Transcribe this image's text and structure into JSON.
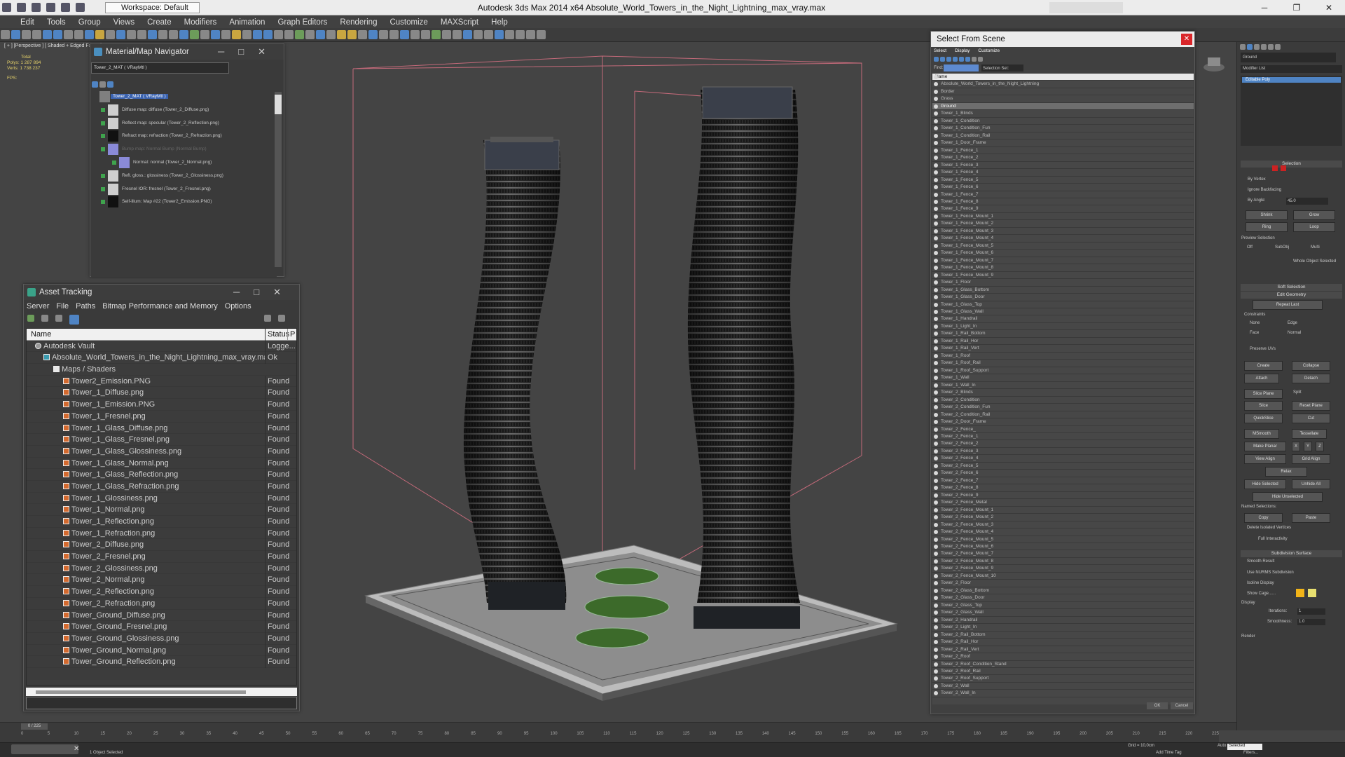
{
  "app": {
    "window_title": "Autodesk 3ds Max  2014 x64    Absolute_World_Towers_in_the_Night_Lightning_max_vray.max",
    "workspace": "Workspace: Default"
  },
  "menu": [
    "Edit",
    "Tools",
    "Group",
    "Views",
    "Create",
    "Modifiers",
    "Animation",
    "Graph Editors",
    "Rendering",
    "Customize",
    "MAXScript",
    "Help"
  ],
  "viewport": {
    "label": "[ + ] [Perspective ] [ Shaded + Edged Faces ]",
    "stats_total": "Total",
    "stats_polys": "Polys:  1 287 894",
    "stats_verts": "Verts:   1 738 237",
    "fps": "FPS:"
  },
  "mat_nav": {
    "title": "Material/Map Navigator",
    "field": "Tower_2_MAT  ( VRayMtl )",
    "root": "Tower_2_MAT  ( VRayMtl )",
    "items": [
      "Diffuse map: diffuse (Tower_2_Diffuse.png)",
      "Reflect map: specular (Tower_2_Reflection.png)",
      "Refract map: refraction (Tower_2_Refraction.png)",
      "Bump map: Normal Bump (Normal Bump)",
      "Normal: normal (Tower_2_Normal.png)",
      "Refl. gloss.: glossiness (Tower_2_Glossiness.png)",
      "Fresnel IOR: fresnel (Tower_2_Fresnel.png)",
      "Self-illum: Map #22 (Tower2_Emission.PNG)"
    ]
  },
  "asset": {
    "title": "Asset Tracking",
    "menu": [
      "Server",
      "File",
      "Paths",
      "Bitmap Performance and Memory",
      "Options"
    ],
    "col_name": "Name",
    "col_status": "Status",
    "col_p": "P",
    "vault": {
      "name": "Autodesk Vault",
      "status": "Logge..."
    },
    "file": {
      "name": "Absolute_World_Towers_in_the_Night_Lightning_max_vray.max",
      "status": "Ok"
    },
    "folder": "Maps / Shaders",
    "rows": [
      [
        "Tower2_Emission.PNG",
        "Found"
      ],
      [
        "Tower_1_Diffuse.png",
        "Found"
      ],
      [
        "Tower_1_Emission.PNG",
        "Found"
      ],
      [
        "Tower_1_Fresnel.png",
        "Found"
      ],
      [
        "Tower_1_Glass_Diffuse.png",
        "Found"
      ],
      [
        "Tower_1_Glass_Fresnel.png",
        "Found"
      ],
      [
        "Tower_1_Glass_Glossiness.png",
        "Found"
      ],
      [
        "Tower_1_Glass_Normal.png",
        "Found"
      ],
      [
        "Tower_1_Glass_Reflection.png",
        "Found"
      ],
      [
        "Tower_1_Glass_Refraction.png",
        "Found"
      ],
      [
        "Tower_1_Glossiness.png",
        "Found"
      ],
      [
        "Tower_1_Normal.png",
        "Found"
      ],
      [
        "Tower_1_Reflection.png",
        "Found"
      ],
      [
        "Tower_1_Refraction.png",
        "Found"
      ],
      [
        "Tower_2_Diffuse.png",
        "Found"
      ],
      [
        "Tower_2_Fresnel.png",
        "Found"
      ],
      [
        "Tower_2_Glossiness.png",
        "Found"
      ],
      [
        "Tower_2_Normal.png",
        "Found"
      ],
      [
        "Tower_2_Reflection.png",
        "Found"
      ],
      [
        "Tower_2_Refraction.png",
        "Found"
      ],
      [
        "Tower_Ground_Diffuse.png",
        "Found"
      ],
      [
        "Tower_Ground_Fresnel.png",
        "Found"
      ],
      [
        "Tower_Ground_Glossiness.png",
        "Found"
      ],
      [
        "Tower_Ground_Normal.png",
        "Found"
      ],
      [
        "Tower_Ground_Reflection.png",
        "Found"
      ]
    ]
  },
  "scene": {
    "title": "Select From Scene",
    "menu": [
      "Select",
      "Display",
      "Customize"
    ],
    "find_label": "Find:",
    "selset_label": "Selection Set:",
    "col_name": "Name",
    "ok": "OK",
    "cancel": "Cancel",
    "selected": "Ground",
    "items": [
      "Absolute_World_Towers_in_the_Night_Lightning",
      "Border",
      "Grass",
      "Ground",
      "Tower_1_Blinds",
      "Tower_1_Condition",
      "Tower_1_Condition_Fun",
      "Tower_1_Condition_Rail",
      "Tower_1_Door_Frame",
      "Tower_1_Fence_1",
      "Tower_1_Fence_2",
      "Tower_1_Fence_3",
      "Tower_1_Fence_4",
      "Tower_1_Fence_5",
      "Tower_1_Fence_6",
      "Tower_1_Fence_7",
      "Tower_1_Fence_8",
      "Tower_1_Fence_9",
      "Tower_1_Fence_Mount_1",
      "Tower_1_Fence_Mount_2",
      "Tower_1_Fence_Mount_3",
      "Tower_1_Fence_Mount_4",
      "Tower_1_Fence_Mount_5",
      "Tower_1_Fence_Mount_6",
      "Tower_1_Fence_Mount_7",
      "Tower_1_Fence_Mount_8",
      "Tower_1_Fence_Mount_9",
      "Tower_1_Floor",
      "Tower_1_Glass_Bottom",
      "Tower_1_Glass_Door",
      "Tower_1_Glass_Top",
      "Tower_1_Glass_Wall",
      "Tower_1_Handrail",
      "Tower_1_Light_In",
      "Tower_1_Rail_Bottom",
      "Tower_1_Rail_Hor",
      "Tower_1_Rail_Vert",
      "Tower_1_Roof",
      "Tower_1_Roof_Rail",
      "Tower_1_Roof_Support",
      "Tower_1_Wall",
      "Tower_1_Wall_In",
      "Tower_2_Blinds",
      "Tower_2_Condition",
      "Tower_2_Condition_Fun",
      "Tower_2_Condition_Rail",
      "Tower_2_Door_Frame",
      "Tower_2_Fence_",
      "Tower_2_Fence_1",
      "Tower_2_Fence_2",
      "Tower_2_Fence_3",
      "Tower_2_Fence_4",
      "Tower_2_Fence_5",
      "Tower_2_Fence_6",
      "Tower_2_Fence_7",
      "Tower_2_Fence_8",
      "Tower_2_Fence_9",
      "Tower_2_Fence_Metal",
      "Tower_2_Fence_Mount_1",
      "Tower_2_Fence_Mount_2",
      "Tower_2_Fence_Mount_3",
      "Tower_2_Fence_Mount_4",
      "Tower_2_Fence_Mount_5",
      "Tower_2_Fence_Mount_6",
      "Tower_2_Fence_Mount_7",
      "Tower_2_Fence_Mount_8",
      "Tower_2_Fence_Mount_9",
      "Tower_2_Fence_Mount_10",
      "Tower_2_Floor",
      "Tower_2_Glass_Bottom",
      "Tower_2_Glass_Door",
      "Tower_2_Glass_Top",
      "Tower_2_Glass_Wall",
      "Tower_2_Handrail",
      "Tower_2_Light_In",
      "Tower_2_Rail_Bottom",
      "Tower_2_Rail_Hor",
      "Tower_2_Rail_Vert",
      "Tower_2_Roof",
      "Tower_2_Roof_Condition_Stand",
      "Tower_2_Roof_Rail",
      "Tower_2_Roof_Support",
      "Tower_2_Wall",
      "Tower_2_Wall_In"
    ]
  },
  "cmd": {
    "object_name": "Ground",
    "modifier_list": "Modifier List",
    "stack_item": "Editable Poly",
    "selection": "Selection",
    "by_vertex": "By Vertex",
    "ignore_backfacing": "Ignore Backfacing",
    "by_angle": "By Angle:",
    "angle_val": "45.0",
    "shrink": "Shrink",
    "grow": "Grow",
    "ring": "Ring",
    "loop": "Loop",
    "preview_selection": "Preview Selection",
    "off": "Off",
    "subobj": "SubObj",
    "multi": "Multi",
    "whole_object": "Whole Object Selected",
    "soft_selection": "Soft Selection",
    "edit_geometry": "Edit Geometry",
    "repeat_last": "Repeat Last",
    "constraints": "Constraints",
    "none": "None",
    "edge": "Edge",
    "face": "Face",
    "normal": "Normal",
    "preserve_uvs": "Preserve UVs",
    "create": "Create",
    "collapse": "Collapse",
    "attach": "Attach",
    "detach": "Detach",
    "slice_plane": "Slice Plane",
    "split": "Split",
    "slice": "Slice",
    "reset_plane": "Reset Plane",
    "quickslice": "QuickSlice",
    "cut": "Cut",
    "msmooth": "MSmooth",
    "tessellate": "Tessellate",
    "make_planar": "Make Planar",
    "x": "X",
    "y": "Y",
    "z": "Z",
    "view_align": "View Align",
    "grid_align": "Grid Align",
    "relax": "Relax",
    "hide_selected": "Hide Selected",
    "unhide_all": "Unhide All",
    "hide_unselected": "Hide Unselected",
    "named_selections": "Named Selections:",
    "copy": "Copy",
    "paste": "Paste",
    "delete_isolated": "Delete Isolated Vertices",
    "full_interactivity": "Full Interactivity",
    "subdivision_surface": "Subdivision Surface",
    "smooth_result": "Smooth Result",
    "use_nurms": "Use NURMS Subdivision",
    "isoline_display": "Isoline Display",
    "show_cage": "Show Cage......",
    "display": "Display",
    "iterations": "Iterations:",
    "iterations_val": "1",
    "smoothness": "Smoothness:",
    "smoothness_val": "1.0",
    "render": "Render",
    "cage_color1": "#f2b418",
    "cage_color2": "#e8e070"
  },
  "status": {
    "frame": "0 / 225",
    "ticks": [
      "0",
      "5",
      "10",
      "15",
      "20",
      "25",
      "30",
      "35",
      "40",
      "45",
      "50",
      "55",
      "60",
      "65",
      "70",
      "75",
      "80",
      "85",
      "90",
      "95",
      "100",
      "105",
      "110",
      "115",
      "120",
      "125",
      "130",
      "135",
      "140",
      "145",
      "150",
      "155",
      "160",
      "165",
      "170",
      "175",
      "180",
      "185",
      "190",
      "195",
      "200",
      "205",
      "210",
      "215",
      "220",
      "225"
    ],
    "objects": "1 Object Selected",
    "grid": "Grid = 10,0cm",
    "add_time_tag": "Add Time Tag",
    "auto": "Auto",
    "selected": "Selected",
    "filters": "Filters..."
  },
  "colors": {
    "accent": "#4f84c4",
    "selected_row": "#6e6e6e",
    "found": "#cfcfcf"
  }
}
